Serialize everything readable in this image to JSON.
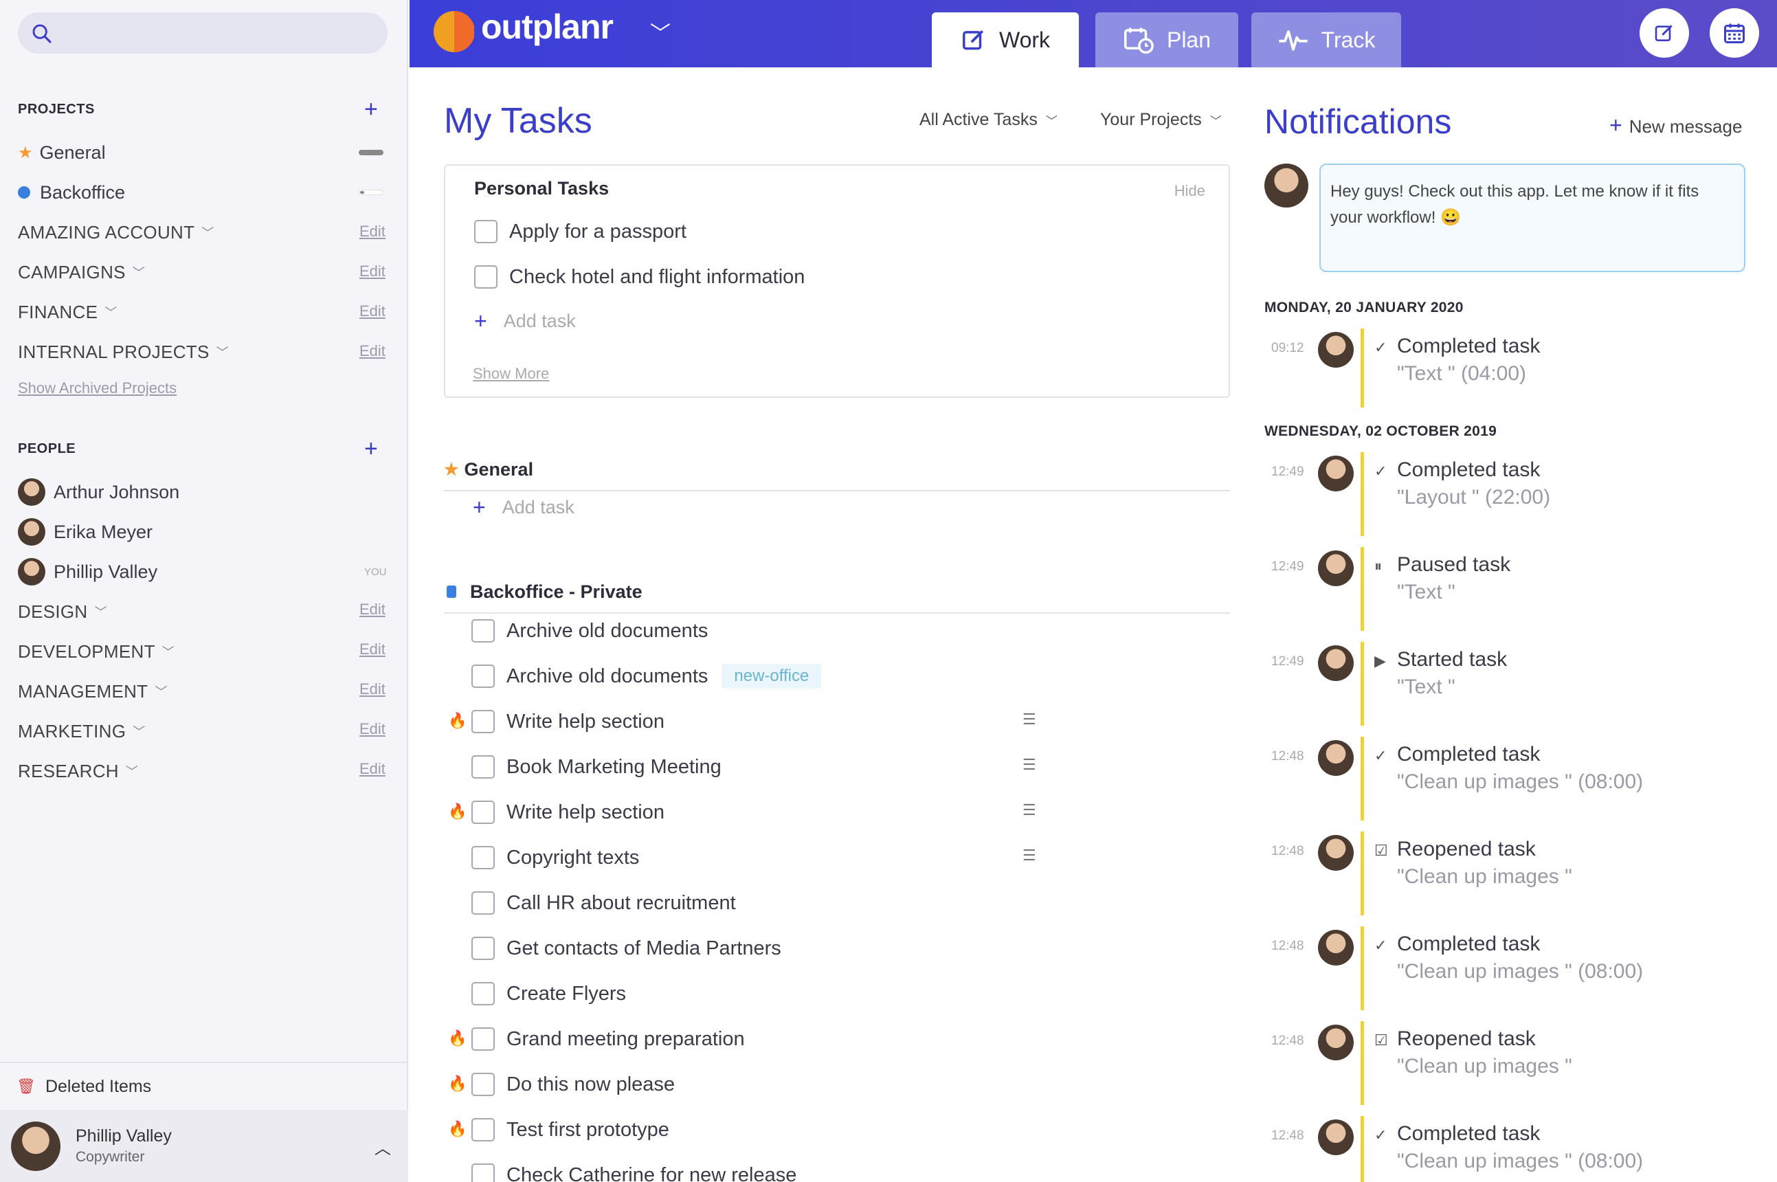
{
  "sidebar": {
    "search_placeholder": "",
    "projects_title": "PROJECTS",
    "projects": [
      {
        "name": "General"
      },
      {
        "name": "Backoffice"
      }
    ],
    "groups": [
      {
        "name": "AMAZING ACCOUNT",
        "edit": "Edit"
      },
      {
        "name": "CAMPAIGNS",
        "edit": "Edit"
      },
      {
        "name": "FINANCE",
        "edit": "Edit"
      },
      {
        "name": "INTERNAL PROJECTS",
        "edit": "Edit"
      }
    ],
    "archived_link": "Show Archived Projects",
    "people_title": "PEOPLE",
    "people": [
      {
        "name": "Arthur Johnson"
      },
      {
        "name": "Erika Meyer"
      },
      {
        "name": "Phillip Valley",
        "badge": "YOU"
      }
    ],
    "people_groups": [
      {
        "name": "DESIGN",
        "edit": "Edit"
      },
      {
        "name": "DEVELOPMENT",
        "edit": "Edit"
      },
      {
        "name": "MANAGEMENT",
        "edit": "Edit"
      },
      {
        "name": "MARKETING",
        "edit": "Edit"
      },
      {
        "name": "RESEARCH",
        "edit": "Edit"
      }
    ],
    "deleted_label": "Deleted Items",
    "user": {
      "name": "Phillip Valley",
      "role": "Copywriter"
    }
  },
  "topbar": {
    "brand": "outplanr",
    "tabs": [
      {
        "label": "Work",
        "active": true
      },
      {
        "label": "Plan",
        "active": false
      },
      {
        "label": "Track",
        "active": false
      }
    ],
    "accent": "#3b3ed8"
  },
  "tasks": {
    "title": "My Tasks",
    "filter_status": "All Active Tasks",
    "filter_projects": "Your Projects",
    "personal": {
      "title": "Personal Tasks",
      "hide": "Hide",
      "items": [
        "Apply for a passport",
        "Check hotel and flight information"
      ],
      "add": "Add task",
      "show_more": "Show More"
    },
    "general": {
      "title": "General",
      "add": "Add task"
    },
    "backoffice": {
      "title": "Backoffice - Private",
      "items": [
        {
          "text": "Archive old documents",
          "urgent": false,
          "tag": "",
          "list": false
        },
        {
          "text": "Archive old documents",
          "urgent": false,
          "tag": "new-office",
          "list": false
        },
        {
          "text": "Write help section",
          "urgent": true,
          "tag": "",
          "list": true
        },
        {
          "text": "Book Marketing Meeting",
          "urgent": false,
          "tag": "",
          "list": true
        },
        {
          "text": "Write help section",
          "urgent": true,
          "tag": "",
          "list": true
        },
        {
          "text": "Copyright texts",
          "urgent": false,
          "tag": "",
          "list": true
        },
        {
          "text": "Call HR about recruitment",
          "urgent": false,
          "tag": "",
          "list": false
        },
        {
          "text": "Get contacts of Media Partners",
          "urgent": false,
          "tag": "",
          "list": false
        },
        {
          "text": "Create Flyers",
          "urgent": false,
          "tag": "",
          "list": false
        },
        {
          "text": "Grand meeting preparation",
          "urgent": true,
          "tag": "",
          "list": false
        },
        {
          "text": "Do this now please",
          "urgent": true,
          "tag": "",
          "list": false
        },
        {
          "text": "Test first prototype",
          "urgent": true,
          "tag": "",
          "list": false
        },
        {
          "text": "Check Catherine for new release",
          "urgent": false,
          "tag": "",
          "list": false
        }
      ]
    }
  },
  "notifications": {
    "title": "Notifications",
    "new_message": "New message",
    "message": "Hey guys! Check out this app. Let me know if it fits your workflow! 😀",
    "dates": [
      "MONDAY, 20 JANUARY 2020",
      "WEDNESDAY, 02 OCTOBER 2019"
    ],
    "items": [
      {
        "time": "09:12",
        "icon": "check-icon",
        "action": "Completed task",
        "object": "\"Text \" (04:00)"
      },
      {
        "time": "12:49",
        "icon": "check-icon",
        "action": "Completed task",
        "object": "\"Layout \" (22:00)"
      },
      {
        "time": "12:49",
        "icon": "pause-icon",
        "action": "Paused task",
        "object": "\"Text \""
      },
      {
        "time": "12:49",
        "icon": "play-icon",
        "action": "Started task",
        "object": "\"Text \""
      },
      {
        "time": "12:48",
        "icon": "check-icon",
        "action": "Completed task",
        "object": "\"Clean up images \" (08:00)"
      },
      {
        "time": "12:48",
        "icon": "reopen-icon",
        "action": "Reopened task",
        "object": "\"Clean up images \""
      },
      {
        "time": "12:48",
        "icon": "check-icon",
        "action": "Completed task",
        "object": "\"Clean up images \" (08:00)"
      },
      {
        "time": "12:48",
        "icon": "reopen-icon",
        "action": "Reopened task",
        "object": "\"Clean up images \""
      },
      {
        "time": "12:48",
        "icon": "check-icon",
        "action": "Completed task",
        "object": "\"Clean up images \" (08:00)"
      }
    ]
  }
}
